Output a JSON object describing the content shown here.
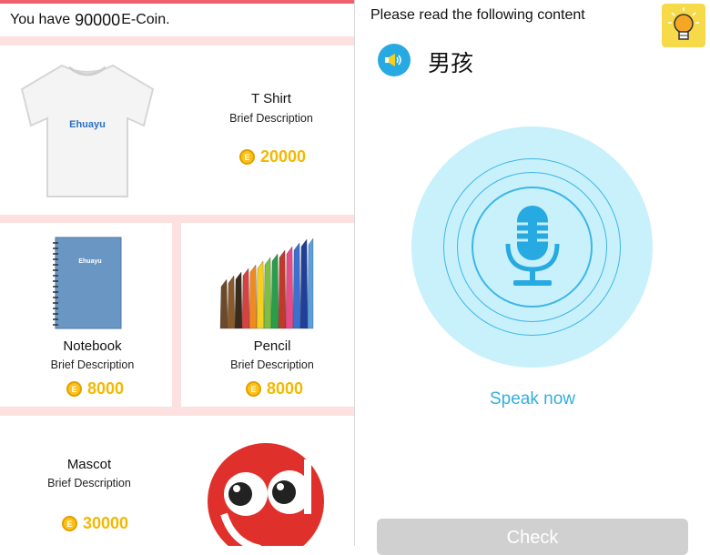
{
  "store": {
    "balance_prefix": "You have",
    "balance_amount": "90000",
    "balance_suffix": "E-Coin.",
    "coin_symbol": "E",
    "items": [
      {
        "name": "T Shirt",
        "description": "Brief Description",
        "price": "20000",
        "image": "tshirt-image",
        "image_text": "Ehuayu"
      },
      {
        "name": "Notebook",
        "description": "Brief Description",
        "price": "8000",
        "image": "notebook-image",
        "image_text": "Ehuayu"
      },
      {
        "name": "Pencil",
        "description": "Brief Description",
        "price": "8000",
        "image": "pencils-image"
      },
      {
        "name": "Mascot",
        "description": "Brief Description",
        "price": "30000",
        "image": "mascot-image"
      }
    ]
  },
  "speaking": {
    "instruction": "Please read the following content",
    "word": "男孩",
    "speak_label": "Speak now",
    "check_label": "Check",
    "hint_icon": "lightbulb-icon",
    "speaker_icon": "speaker-icon",
    "mic_icon": "microphone-icon"
  },
  "colors": {
    "accent_red": "#f0626b",
    "section_pink": "#fde0e0",
    "coin_gold": "#f5b800",
    "mic_bg": "#c8f1fb",
    "mic_blue": "#27a9e1",
    "hint_yellow": "#f7da4a",
    "check_disabled": "#d0d0d0"
  }
}
